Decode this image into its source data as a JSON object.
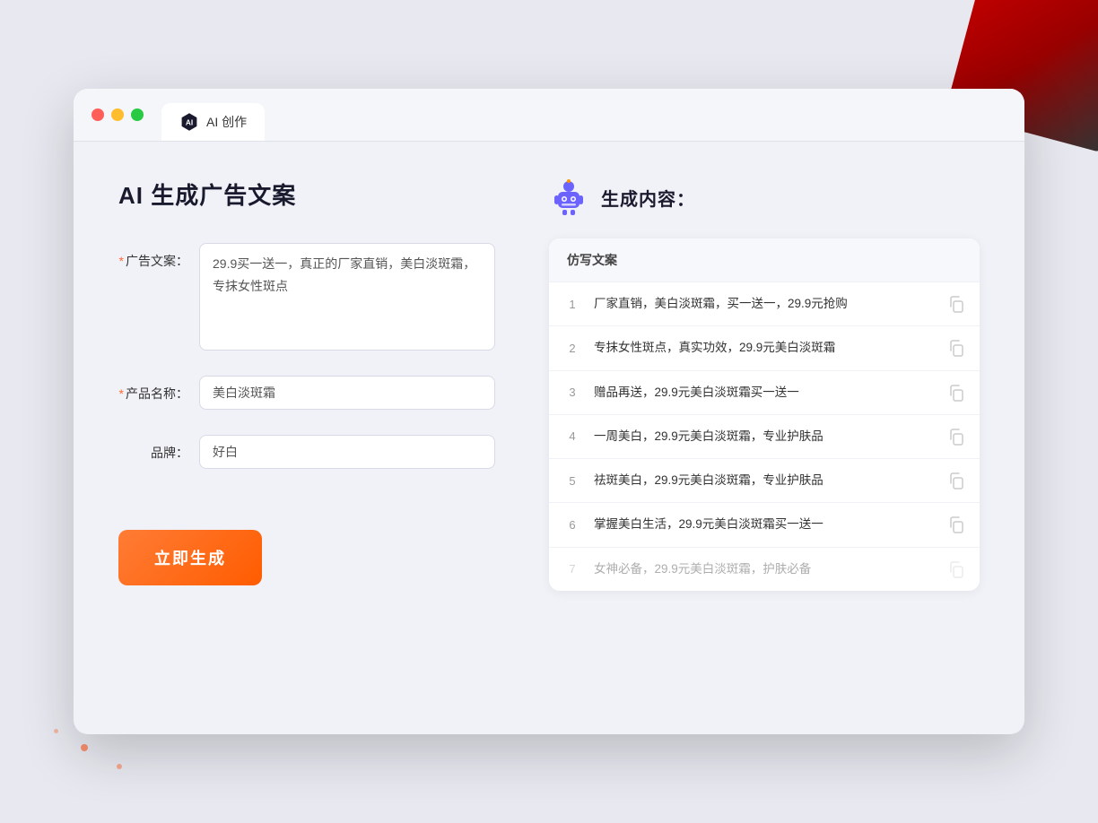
{
  "window": {
    "title": "AI 创作",
    "controls": {
      "close": "close",
      "minimize": "minimize",
      "maximize": "maximize"
    }
  },
  "left": {
    "page_title": "AI 生成广告文案",
    "form": {
      "ad_copy_label": "广告文案：",
      "ad_copy_required": "*",
      "ad_copy_value": "29.9买一送一，真正的厂家直销，美白淡斑霜，专抹女性斑点",
      "product_name_label": "产品名称：",
      "product_name_required": "*",
      "product_name_value": "美白淡斑霜",
      "brand_label": "品牌：",
      "brand_value": "好白"
    },
    "generate_button": "立即生成"
  },
  "right": {
    "section_title": "生成内容：",
    "table_header": "仿写文案",
    "results": [
      {
        "num": 1,
        "text": "厂家直销，美白淡斑霜，买一送一，29.9元抢购",
        "faded": false
      },
      {
        "num": 2,
        "text": "专抹女性斑点，真实功效，29.9元美白淡斑霜",
        "faded": false
      },
      {
        "num": 3,
        "text": "赠品再送，29.9元美白淡斑霜买一送一",
        "faded": false
      },
      {
        "num": 4,
        "text": "一周美白，29.9元美白淡斑霜，专业护肤品",
        "faded": false
      },
      {
        "num": 5,
        "text": "祛斑美白，29.9元美白淡斑霜，专业护肤品",
        "faded": false
      },
      {
        "num": 6,
        "text": "掌握美白生活，29.9元美白淡斑霜买一送一",
        "faded": false
      },
      {
        "num": 7,
        "text": "女神必备，29.9元美白淡斑霜，护肤必备",
        "faded": true
      }
    ]
  },
  "colors": {
    "orange": "#ff6b35",
    "purple": "#6c63ff",
    "accent": "#7c8cf8"
  }
}
